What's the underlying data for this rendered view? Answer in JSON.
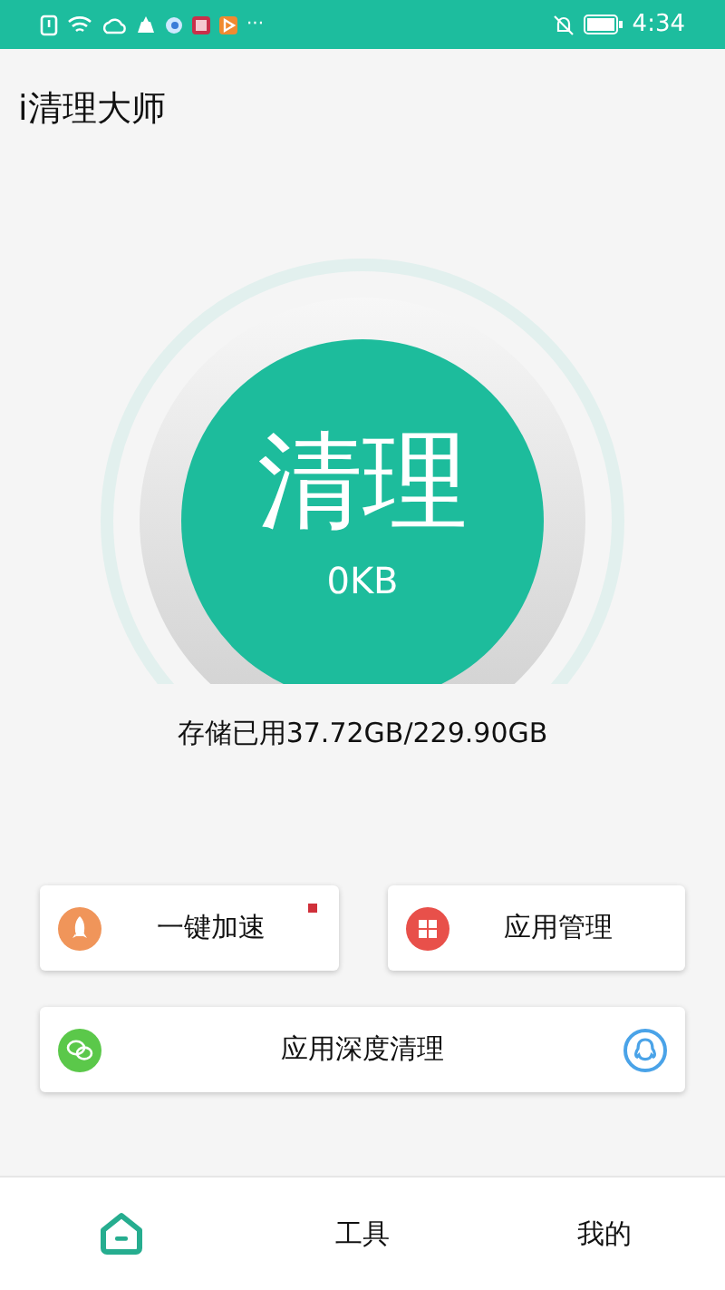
{
  "status_bar": {
    "time": "4:34",
    "more": "···"
  },
  "app_title": "i清理大师",
  "clean_dial": {
    "label": "清理",
    "amount": "0KB"
  },
  "storage": "存储已用37.72GB/229.90GB",
  "cards": [
    {
      "kind": "rocket",
      "label": "一键加速",
      "badge": true,
      "wide": false
    },
    {
      "kind": "apps",
      "label": "应用管理",
      "badge": false,
      "wide": false
    },
    {
      "kind": "chat",
      "label": "应用深度清理",
      "badge": false,
      "wide": true
    }
  ],
  "tabs": [
    {
      "kind": "home",
      "selected": true
    },
    {
      "kind": "text",
      "label": "工具",
      "selected": false
    },
    {
      "kind": "text",
      "label": "我的",
      "selected": false
    }
  ]
}
